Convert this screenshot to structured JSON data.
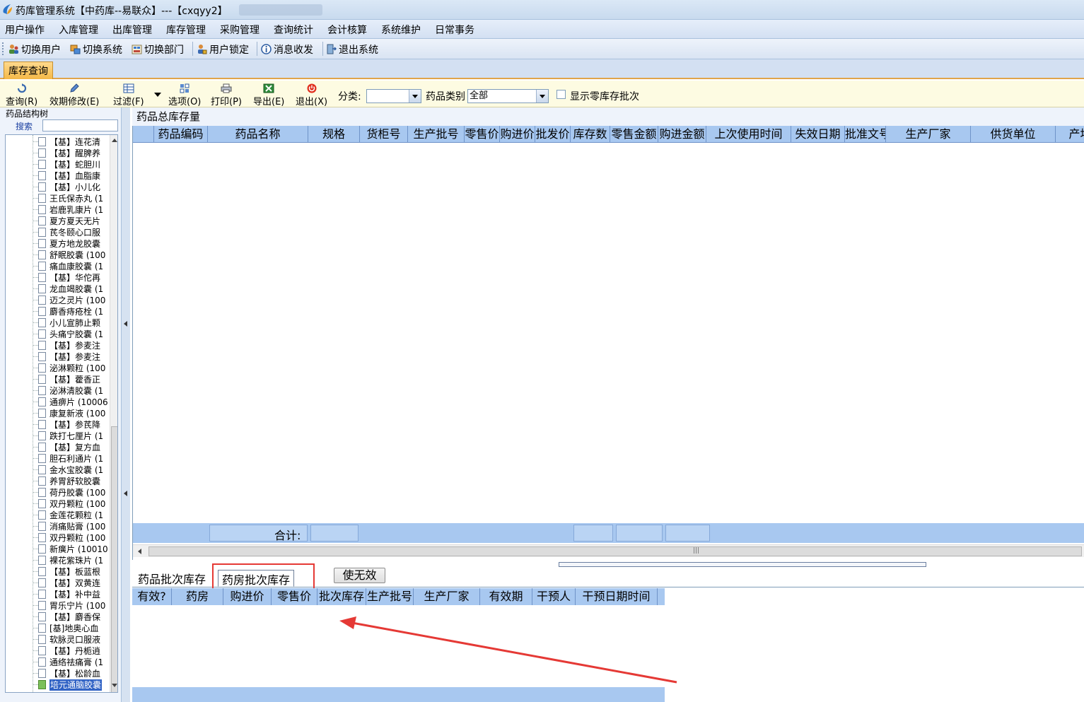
{
  "window": {
    "title": "药库管理系统【中药库--易联众】---【cxqyy2】"
  },
  "menu": [
    "用户操作",
    "入库管理",
    "出库管理",
    "库存管理",
    "采购管理",
    "查询统计",
    "会计核算",
    "系统维护",
    "日常事务"
  ],
  "toolbar": {
    "switch_user": "切换用户",
    "switch_system": "切换系统",
    "switch_dept": "切换部门",
    "user_lock": "用户锁定",
    "message": "消息收发",
    "exit_system": "退出系统"
  },
  "module_tab": "库存查询",
  "filterbar": {
    "query": "查询(R)",
    "expiry_edit": "效期修改(E)",
    "filter": "过滤(F)",
    "options": "选项(O)",
    "print": "打印(P)",
    "export": "导出(E)",
    "exit": "退出(X)",
    "category_label": "分类:",
    "category_value": "",
    "drug_type_label": "药品类别",
    "drug_type_value": "全部",
    "show_zero_label": "显示零库存批次",
    "show_zero_checked": false
  },
  "tree": {
    "title": "药品结构树",
    "search_label": "搜索",
    "search_value": "",
    "items": [
      "【基】连花清",
      "【基】醒脾养",
      "【基】蛇胆川",
      "【基】血脂康",
      "【基】小儿化",
      "王氏保赤丸 (1",
      "岩鹿乳康片 (1",
      "夏方夏天无片",
      "芪冬颐心口服",
      "夏方地龙胶囊",
      "舒眠胶囊 (100",
      "痛血康胶囊 (1",
      "【基】华佗再",
      "龙血竭胶囊 (1",
      "迈之灵片 (100",
      "麝香痔疮栓 (1",
      "小儿宣肺止颗",
      "头痛宁胶囊 (1",
      "【基】参麦注",
      "【基】参麦注",
      "泌淋颗粒 (100",
      "【基】藿香正",
      "泌淋清胶囊 (1",
      "通痹片 (10006",
      "康复新液 (100",
      "【基】参芪降",
      "跌打七厘片 (1",
      "【基】复方血",
      "胆石利通片 (1",
      "金水宝胶囊 (1",
      "养胃舒软胶囊",
      "荷丹胶囊 (100",
      "双丹颗粒 (100",
      "金莲花颗粒 (1",
      "消痛贴膏 (100",
      "双丹颗粒 (100",
      "新癀片 (10010",
      "裸花紫珠片 (1",
      "【基】板蓝根",
      "【基】双黄连",
      "【基】补中益",
      "胃乐宁片 (100",
      "【基】麝香保",
      "[基]地奥心血",
      "软脉灵口服液",
      "【基】丹栀逍",
      "通络祛痛膏 (1",
      "【基】松龄血",
      "培元通脑胶囊"
    ],
    "selected_index": 48
  },
  "main_grid": {
    "caption": "药品总库存量",
    "columns": [
      "药品编码",
      "药品名称",
      "规格",
      "货柜号",
      "生产批号",
      "零售价",
      "购进价",
      "批发价",
      "库存数",
      "零售金额",
      "购进金额",
      "上次使用时间",
      "失效日期",
      "批准文号",
      "生产厂家",
      "供货单位",
      "产地"
    ],
    "rows": [],
    "total_label": "合计:"
  },
  "bottom": {
    "tabs": [
      "药品批次库存",
      "药房批次库存"
    ],
    "active_tab": 1,
    "invalidate_button": "使无效",
    "columns": [
      "有效?",
      "药房",
      "购进价",
      "零售价",
      "批次库存",
      "生产批号",
      "生产厂家",
      "有效期",
      "干预人",
      "干预日期时间"
    ],
    "rows": []
  },
  "colors": {
    "header_blue": "#a8c8f0",
    "highlight_red": "#e53935",
    "tab_orange": "#f4b847"
  }
}
